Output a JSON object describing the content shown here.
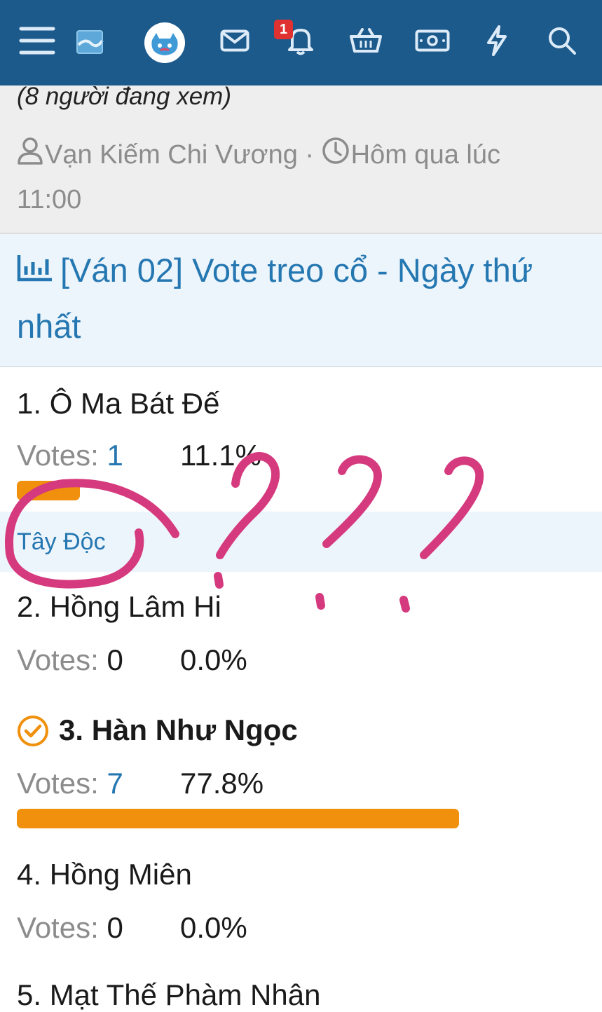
{
  "topbar": {
    "badge_count": "1",
    "icons": [
      "menu-icon",
      "forum-logo",
      "avatar",
      "mail-icon",
      "bell-icon",
      "basket-icon",
      "money-icon",
      "lightning-icon",
      "search-icon"
    ]
  },
  "thread": {
    "viewers": "(8 người đang xem)",
    "author": "Vạn Kiếm Chi Vương",
    "separator": "·",
    "time_line1": "Hôm qua lúc",
    "time_line2": "11:00"
  },
  "poll": {
    "title": "[Ván 02] Vote treo cổ - Ngày thứ nhất",
    "votes_label": "Votes:",
    "group_label": "Tây Độc",
    "options": [
      {
        "label": "1. Ô Ma Bát Đế",
        "votes": "1",
        "percent": "11.1%",
        "fraction": 0.111,
        "voted": false
      },
      {
        "label": "2. Hồng Lâm Hi",
        "votes": "0",
        "percent": "0.0%",
        "fraction": 0,
        "voted": false
      },
      {
        "label": "3. Hàn Như Ngọc",
        "votes": "7",
        "percent": "77.8%",
        "fraction": 0.778,
        "voted": true
      },
      {
        "label": "4. Hồng Miên",
        "votes": "0",
        "percent": "0.0%",
        "fraction": 0,
        "voted": false
      },
      {
        "label": "5. Mạt Thế Phàm Nhân"
      }
    ]
  },
  "annotation": {
    "marks": "???",
    "color": "#d63a7e"
  },
  "colors": {
    "topbar": "#1d5a8c",
    "link": "#2577b1",
    "bar": "#f0900d"
  }
}
